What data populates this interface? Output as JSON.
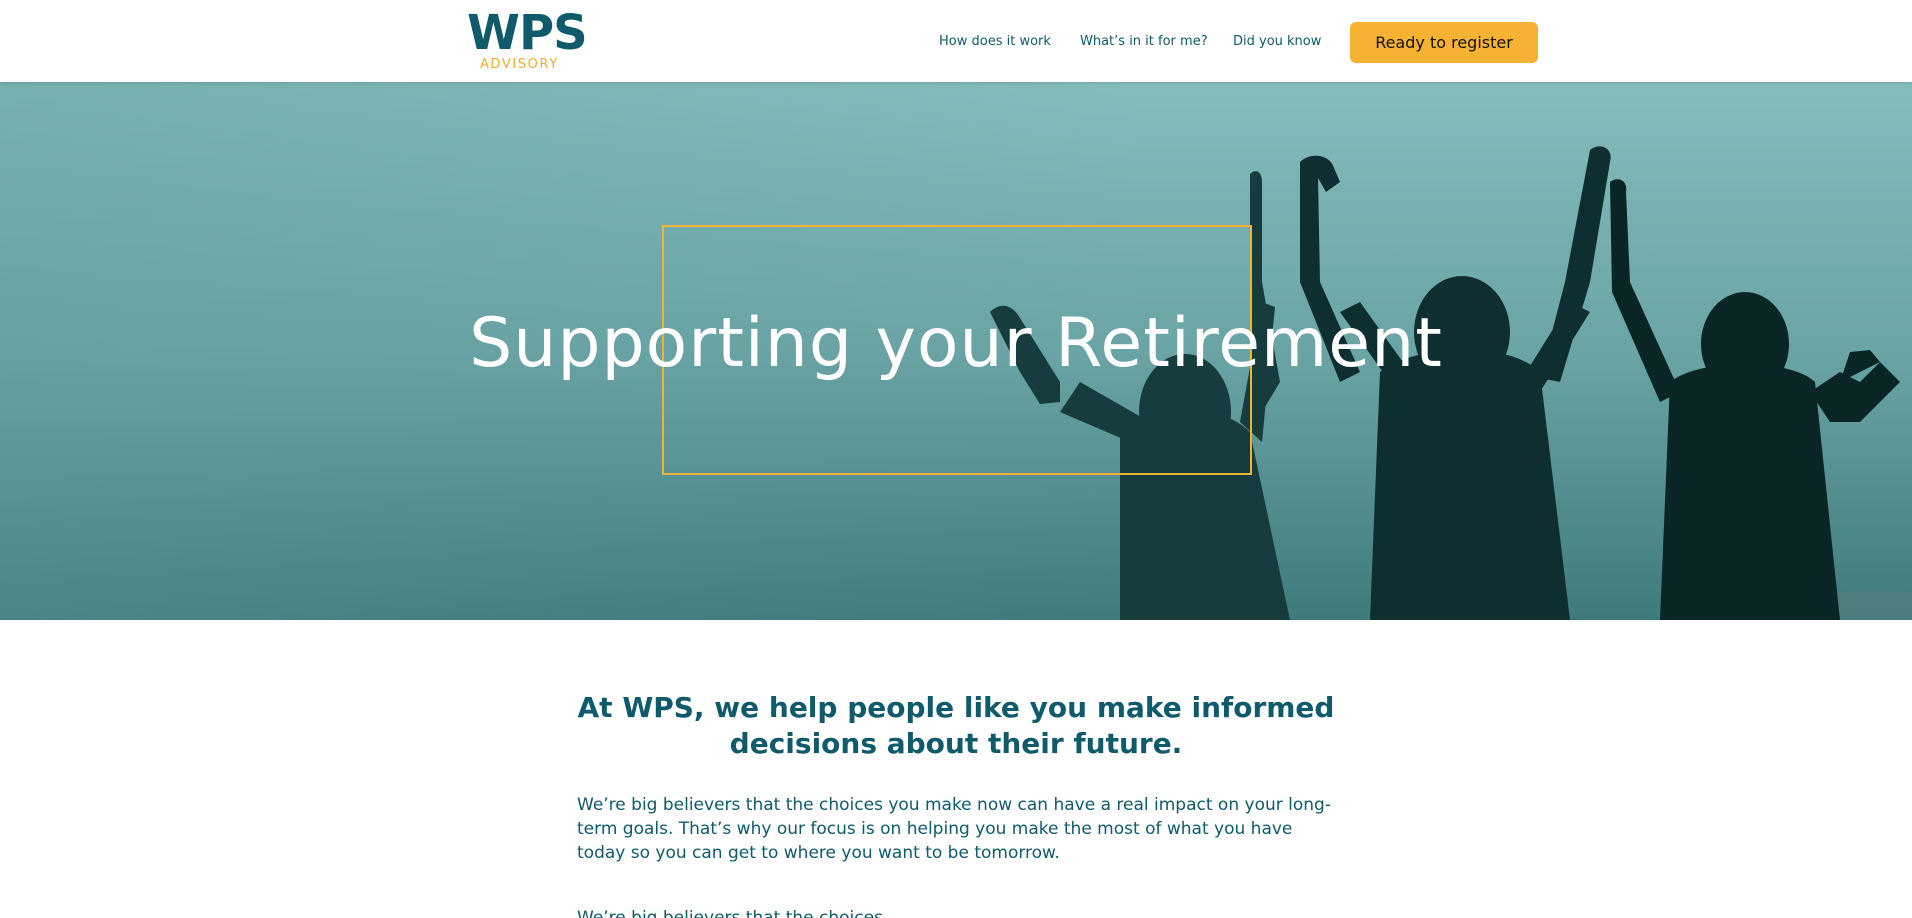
{
  "brand": {
    "logo_primary": "WPS",
    "logo_secondary": "ADVISORY",
    "primary_color": "#0f5a6b",
    "accent_color": "#f4ad2a"
  },
  "nav": {
    "items": [
      {
        "label": "How does it work"
      },
      {
        "label": "What’s in it for me?"
      },
      {
        "label": "Did you know"
      }
    ],
    "cta_label": "Ready to register"
  },
  "hero": {
    "title": "Supporting your Retirement",
    "background_image": "silhouettes of people with raised arms against a teal sky"
  },
  "intro": {
    "heading": "At WPS, we help people like you make informed decisions about their future.",
    "body": "We’re big believers that the choices you make now can have a real impact on your long-term goals. That’s why our focus is on helping you make the most of what you have today so you can get to where you want to be tomorrow.",
    "next_line": "We’re big believers that the choices"
  }
}
